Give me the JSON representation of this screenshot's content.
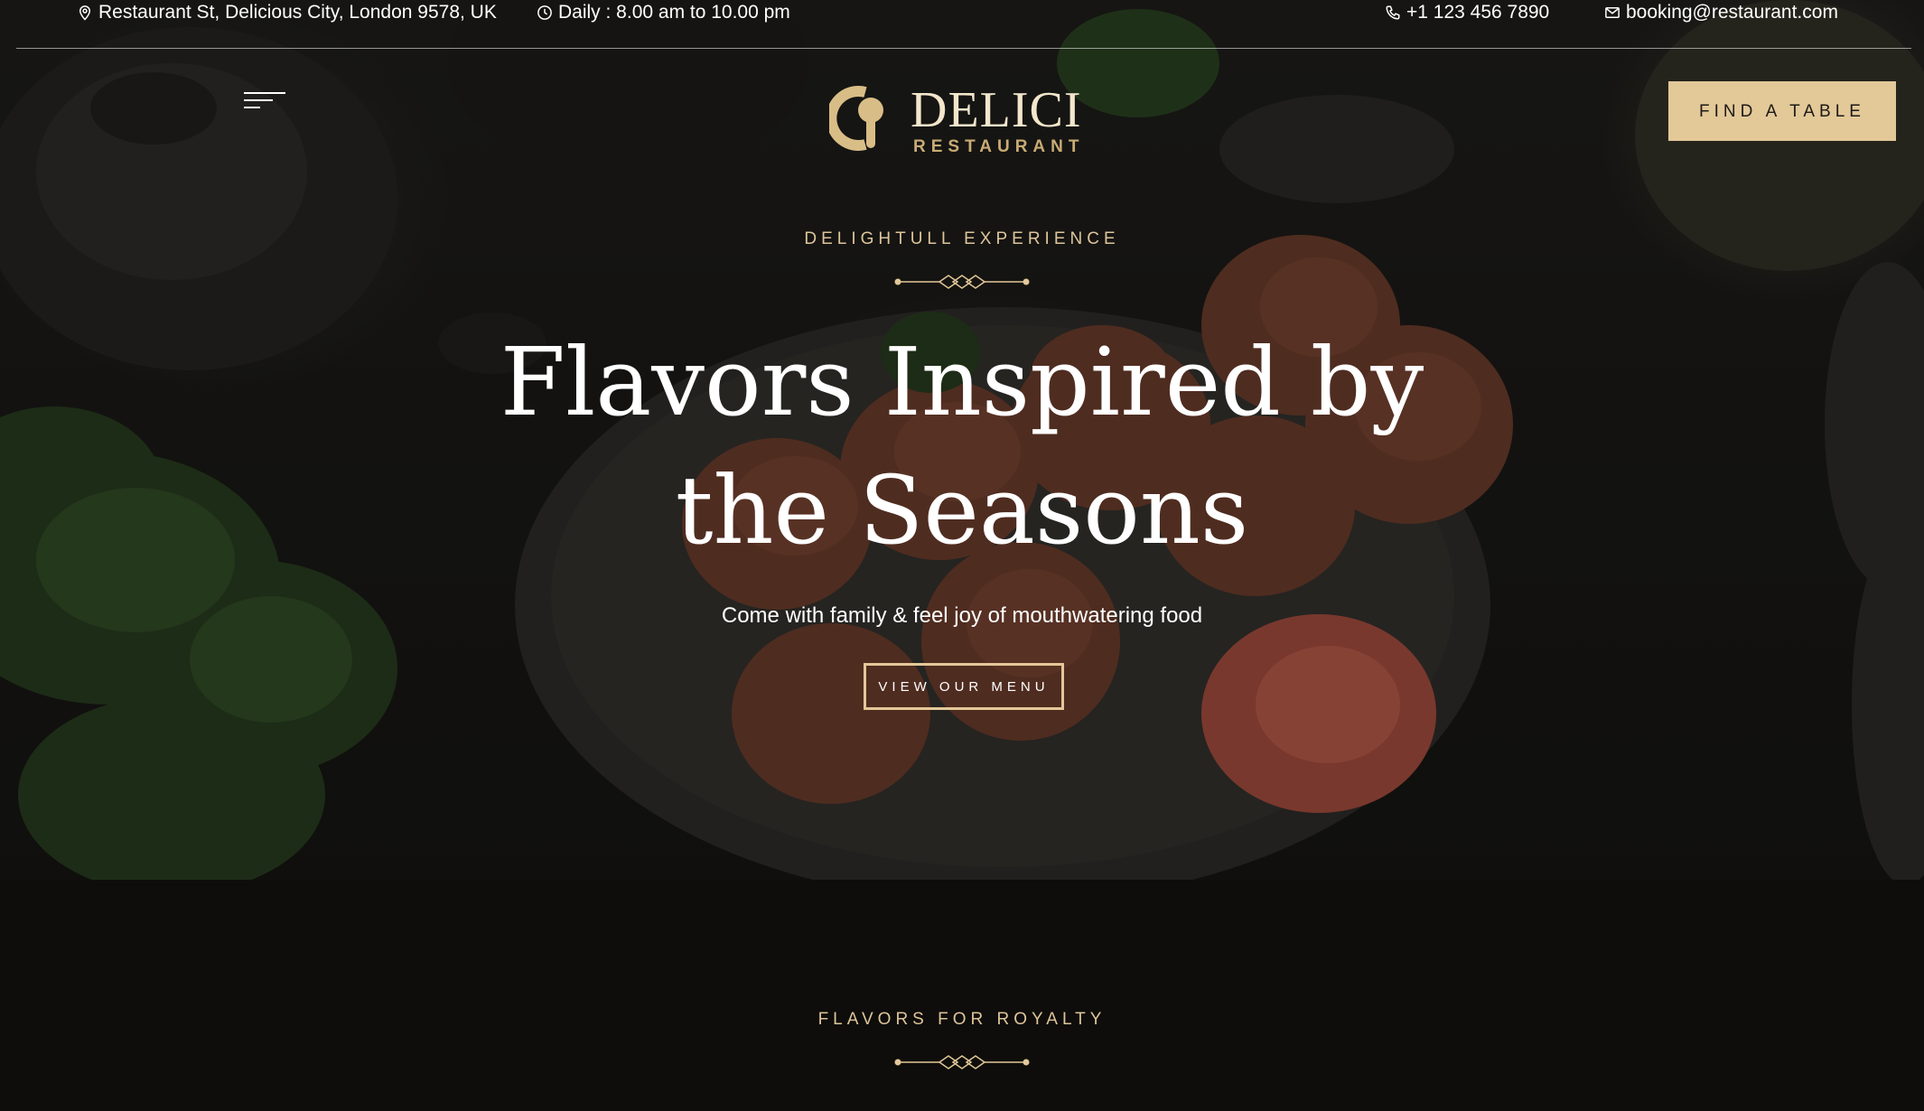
{
  "topbar": {
    "address": "Restaurant St, Delicious City, London 9578, UK",
    "hours": "Daily : 8.00 am to 10.00 pm",
    "phone": "+1 123 456 7890",
    "email": "booking@restaurant.com"
  },
  "header": {
    "logo_name": "DELICI",
    "logo_sub": "RESTAURANT",
    "cta_label": "FIND A TABLE"
  },
  "hero": {
    "eyebrow": "DELIGHTULL EXPERIENCE",
    "title_line1": "Flavors Inspired by",
    "title_line2": "the Seasons",
    "subtitle": "Come with family & feel joy of mouthwatering food",
    "button_label": "VIEW OUR MENU"
  },
  "section": {
    "eyebrow": "FLAVORS FOR ROYALTY"
  },
  "colors": {
    "accent": "#e3c898",
    "eyebrow": "#dec59a",
    "background": "#0e0d0b"
  },
  "icons": [
    "location-pin-icon",
    "clock-icon",
    "phone-icon",
    "mail-icon",
    "hamburger-menu-icon",
    "logo-icon",
    "divider-ornament-icon"
  ]
}
